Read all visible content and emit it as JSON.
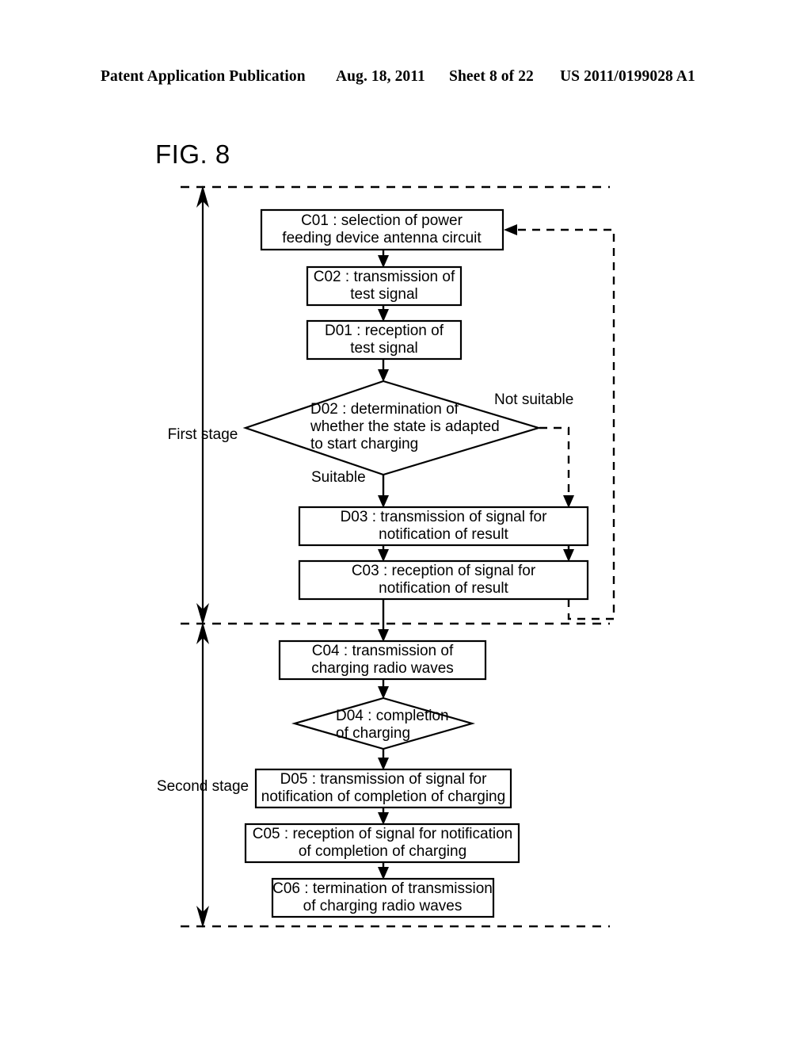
{
  "header": {
    "publication": "Patent Application Publication",
    "date": "Aug. 18, 2011",
    "sheet": "Sheet 8 of 22",
    "document_number": "US 2011/0199028 A1"
  },
  "figure": {
    "label": "FIG. 8",
    "type": "flowchart",
    "stage_labels": {
      "first": "First stage",
      "second": "Second stage"
    },
    "edge_labels": {
      "not_suitable": "Not suitable",
      "suitable": "Suitable"
    },
    "nodes": [
      {
        "id": "C01",
        "shape": "process",
        "lines": [
          "C01 : selection of power",
          "feeding device antenna circuit"
        ]
      },
      {
        "id": "C02",
        "shape": "process",
        "lines": [
          "C02 : transmission of",
          "test signal"
        ]
      },
      {
        "id": "D01",
        "shape": "process",
        "lines": [
          "D01 : reception of",
          "test signal"
        ]
      },
      {
        "id": "D02",
        "shape": "decision",
        "lines": [
          "D02 : determination of",
          "whether the state is adapted",
          "to start charging"
        ]
      },
      {
        "id": "D03",
        "shape": "process",
        "lines": [
          "D03 : transmission of signal for",
          "notification of result"
        ]
      },
      {
        "id": "C03",
        "shape": "process",
        "lines": [
          "C03 : reception of signal for",
          "notification of result"
        ]
      },
      {
        "id": "C04",
        "shape": "process",
        "lines": [
          "C04 : transmission of",
          "charging radio waves"
        ]
      },
      {
        "id": "D04",
        "shape": "decision",
        "lines": [
          "D04 : completion",
          "of charging"
        ]
      },
      {
        "id": "D05",
        "shape": "process",
        "lines": [
          "D05 : transmission of signal for",
          "notification of completion of charging"
        ]
      },
      {
        "id": "C05",
        "shape": "process",
        "lines": [
          "C05 : reception of signal for notification",
          "of completion of charging"
        ]
      },
      {
        "id": "C06",
        "shape": "process",
        "lines": [
          "C06 : termination of transmission",
          "of charging radio waves"
        ]
      }
    ]
  }
}
